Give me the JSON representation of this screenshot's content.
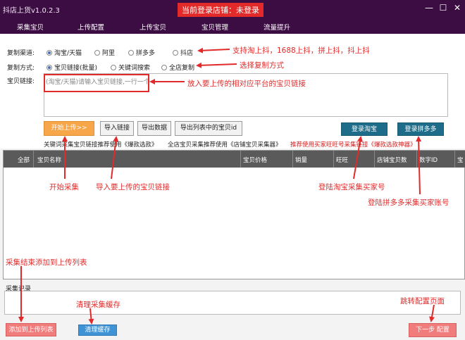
{
  "window": {
    "app_title": "抖店上货v1.0.2.3",
    "login_banner": "当前登录店铺：未登录",
    "minimize": "—",
    "maximize": "☐",
    "close": "✕"
  },
  "tabs": [
    {
      "label": "采集宝贝",
      "active": true
    },
    {
      "label": "上传配置"
    },
    {
      "label": "上传宝贝"
    },
    {
      "label": "宝贝管理"
    },
    {
      "label": "流量提升"
    }
  ],
  "copy_channel": {
    "label": "复制渠道:",
    "options": [
      "淘宝/天猫",
      "阿里",
      "拼多多",
      "抖店"
    ],
    "selected": "淘宝/天猫"
  },
  "copy_method": {
    "label": "复制方式:",
    "options": [
      "宝贝链接(批量)",
      "关键词搜索",
      "全店复制"
    ],
    "selected": "宝贝链接(批量)"
  },
  "link_input": {
    "label": "宝贝链接:",
    "placeholder": "(淘宝/天猫)请输入宝贝链接,一行一个"
  },
  "buttons": {
    "start_upload": "开始上传>>",
    "import_links": "导入链接",
    "export_data": "导出数据",
    "export_ids": "导出列表中的宝贝id",
    "login_taobao": "登录淘宝",
    "login_pdd": "登录拼多多",
    "add_to_upload": "添加到上传列表",
    "clear_cache": "清理缓存",
    "next_step": "下一步 配置"
  },
  "hints": {
    "keyword_hint": "关键词采集宝贝链接推荐使用《爆款选款》",
    "shop_hint": "全店宝贝采集推荐使用《店铺宝贝采集器》",
    "wangwang_hint": "推荐使用买家旺旺号采集链接《爆款选款神器》"
  },
  "table": {
    "columns": [
      "全部",
      "宝贝名称",
      "宝贝价格",
      "销量",
      "旺旺",
      "店铺宝贝数",
      "数字ID",
      "宝"
    ]
  },
  "log": {
    "label": "采集记录"
  },
  "annotations": {
    "channels": "支持淘上抖，1688上抖，拼上抖，抖上抖",
    "method": "选择复制方式",
    "link": "放入要上传的相对应平台的宝贝链接",
    "start": "开始采集",
    "import": "导入要上传的宝贝链接",
    "login_taobao": "登陆淘宝采集买家号",
    "login_pdd": "登陆拼多多采集买家账号",
    "finish": "采集结束添加到上传列表",
    "cache": "清理采集缓存",
    "jump": "跳转配置页面"
  },
  "colors": {
    "titlebar": "#3c0d42",
    "annotation_red": "#e22a2a",
    "start_orange": "#f7a64a",
    "login_teal": "#1d6d8a",
    "add_pink": "#f07c7c",
    "clear_blue": "#3f92d4"
  }
}
